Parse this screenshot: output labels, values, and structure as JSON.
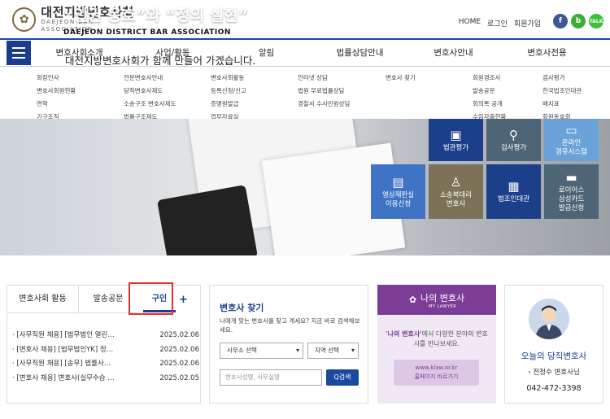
{
  "header": {
    "org_ko": "대전지방변호사회",
    "org_en": "DAEJEON BAR ASSOCIATION",
    "util": [
      "HOME",
      "로그인",
      "회원가입"
    ],
    "social": {
      "facebook": "f",
      "blog": "b",
      "talk": "TALK"
    }
  },
  "nav": [
    "변호사회소개",
    "사업/활동",
    "알림",
    "법률상담안내",
    "변호사안내",
    "변호사전용"
  ],
  "submenus": {
    "c1": [
      "회장인사",
      "변호사회원현황",
      "연혁",
      "기구조직"
    ],
    "c2": [
      "전문변호사안내",
      "당직변호사제도",
      "소송구조 변호사제도",
      "법률구조제도"
    ],
    "c3": [
      "변호사회활동",
      "등록신청/신고",
      "증명원발급",
      "업무자료실"
    ],
    "c4": [
      "인터넷 상담",
      "법원 무료법률상담",
      "경찰서 수사민원상담"
    ],
    "c5": [
      "변호사 찾기"
    ],
    "c6": [
      "회원경조사",
      "발송공문",
      "회의록 공개",
      "수임자출현황"
    ],
    "c7": [
      "검사평가",
      "한국법조인대관",
      "배치표",
      "회원동호회"
    ]
  },
  "banner": {
    "title_part1": "“인권 옹호”와 “정의 실현”",
    "en": "DAEJEON DISTRICT BAR ASSOCIATION",
    "ko": "대전지방변호사회가 함께 만들어 가겠습니다."
  },
  "tiles": [
    {
      "label1": "법관평가",
      "label2": "",
      "icon": "book-icon"
    },
    {
      "label1": "검사평가",
      "label2": "",
      "icon": "search-icon"
    },
    {
      "label1": "온라인",
      "label2": "경유시스템",
      "icon": "monitor-icon"
    },
    {
      "label1": "영상재판실",
      "label2": "이용신청",
      "icon": "video-icon"
    },
    {
      "label1": "소송복대리",
      "label2": "변호사",
      "icon": "person-icon"
    },
    {
      "label1": "법조인대관",
      "label2": "",
      "icon": "computer-icon"
    },
    {
      "label1": "로이어스",
      "label2": "삼성카드",
      "label3": "발급신청",
      "icon": "card-icon"
    }
  ],
  "tabs": {
    "items": [
      "변호사회 활동",
      "발송공문",
      "구인"
    ],
    "plus": "+"
  },
  "news": [
    {
      "title": "· [사무직원 채용] [법무법인 열린…",
      "date": "2025.02.06"
    },
    {
      "title": "· [변호사 채용] [법무법인YK] 청…",
      "date": "2025.02.06"
    },
    {
      "title": "· [사무직원 채용] [송무] 법률사…",
      "date": "2025.02.06"
    },
    {
      "title": "· [변호사 채용] 변호사(실무수습 …",
      "date": "2025.02.05"
    }
  ],
  "find": {
    "title": "변호사 찾기",
    "desc": "나에게 맞는 변호사를 찾고 계세요? 지금 바로 검색해보세요.",
    "sel1": "사무소 선택",
    "sel2": "지역 선택",
    "input_placeholder": "변호사성명, 사무실명",
    "button": "Q검색"
  },
  "mylawyer": {
    "head": "나의 변호사",
    "head_sub": "MY LAWYER",
    "desc_b": "'나의 변호사'",
    "desc": "에서 다양한 분야의 변호사를 만나보세요.",
    "url": "www.klaw.or.kr",
    "link": "홈페이지 바로가기"
  },
  "duty": {
    "title": "오늘의 당직변호사",
    "name": "전정수 변호사님",
    "phone": "042-472-3398"
  },
  "colors": {
    "brand": "#1a3e8c",
    "tile_navy": "#1c3f8a",
    "tile_slate": "#4e6577",
    "tile_blue": "#3f74c4",
    "tile_olive": "#7c7257",
    "tile_sky": "#6ba2d8",
    "purple": "#7c3d96",
    "highlight": "#e0302f"
  }
}
